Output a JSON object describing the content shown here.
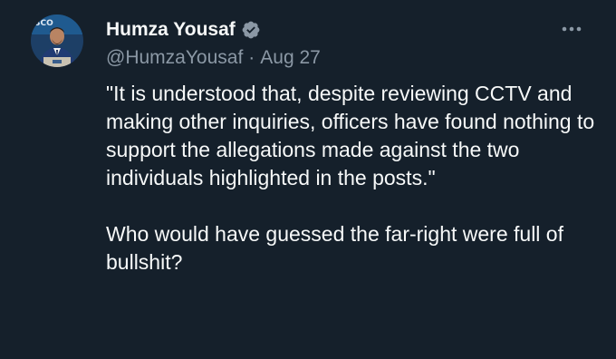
{
  "author": {
    "display_name": "Humza Yousaf",
    "handle": "@HumzaYousaf",
    "date": "Aug 27",
    "separator": "·",
    "verified_icon": "verified-badge-icon",
    "avatar_backdrop_text": "SCO"
  },
  "tweet": {
    "paragraphs": [
      "\"It is understood that, despite reviewing CCTV and making other inquiries, officers have found nothing to support the allegations made against the two individuals highlighted in the posts.\"",
      "Who would have guessed the far-right were full of bullshit?"
    ]
  },
  "menu": {
    "more_icon": "more-options-icon"
  },
  "colors": {
    "background": "#15202b",
    "primary_text": "#f7f9f9",
    "secondary_text": "#8b98a5",
    "verified": "#8b98a5"
  }
}
